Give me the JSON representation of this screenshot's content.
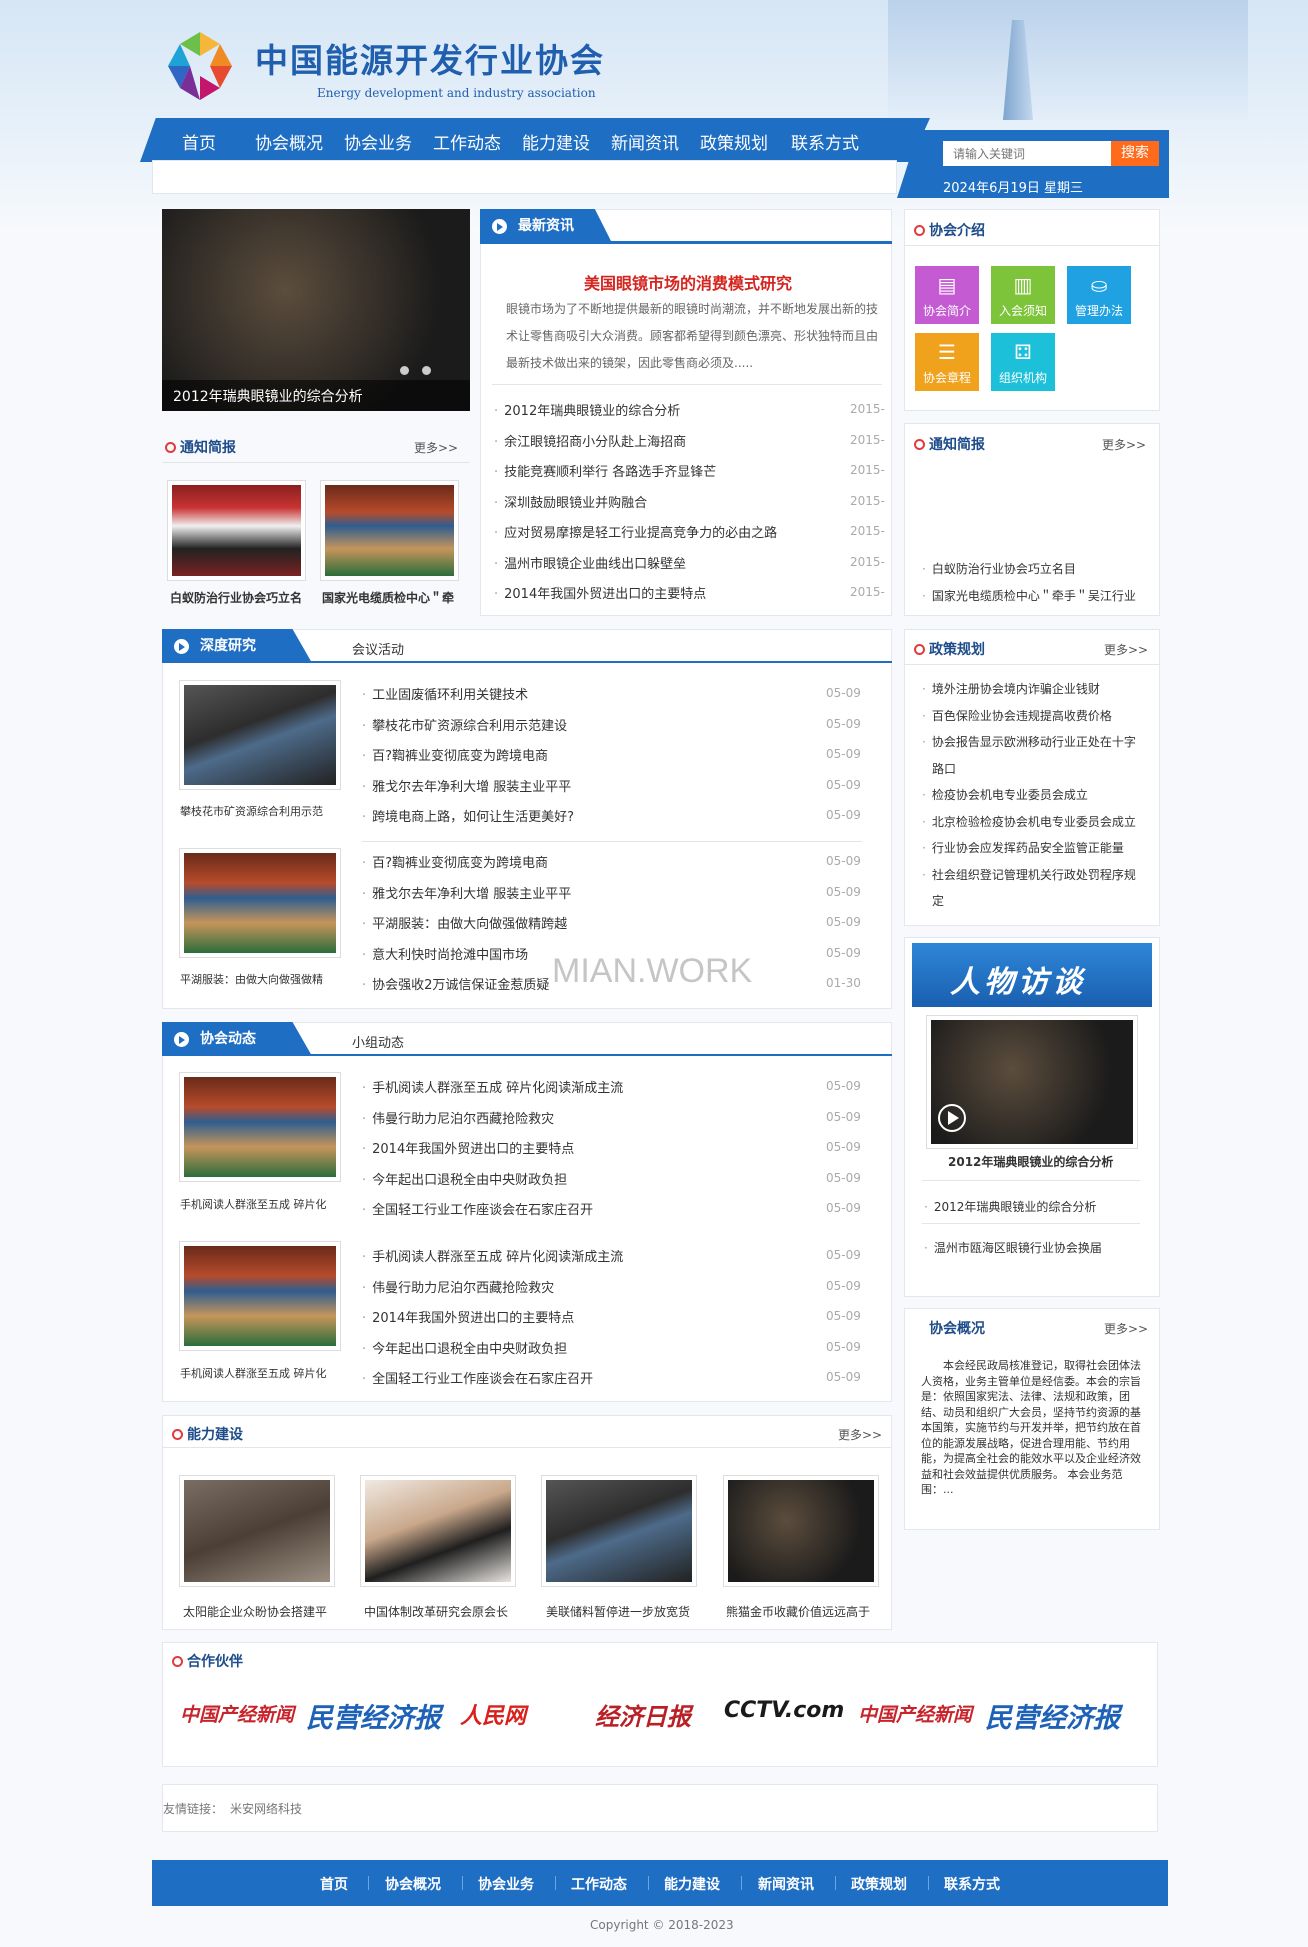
{
  "header": {
    "title": "中国能源开发行业协会",
    "subtitle": "Energy development and industry association"
  },
  "nav": [
    "首页",
    "协会概况",
    "协会业务",
    "工作动态",
    "能力建设",
    "新闻资讯",
    "政策规划",
    "联系方式"
  ],
  "search": {
    "placeholder": "请输入关键词",
    "button": "搜索"
  },
  "date": "2024年6月19日   星期三",
  "slider": {
    "caption": "2012年瑞典眼镜业的综合分析"
  },
  "latest": {
    "tab": "最新资讯",
    "headline": "美国眼镜市场的消费模式研究",
    "summary": "眼镜市场为了不断地提供最新的眼镜时尚潮流，并不断地发展出新的技术让零售商吸引大众消费。顾客都希望得到颜色漂亮、形状独特而且由最新技术做出来的镜架，因此零售商必须及.....",
    "items": [
      {
        "title": "2012年瑞典眼镜业的综合分析",
        "date": "2015-"
      },
      {
        "title": "余江眼镜招商小分队赴上海招商",
        "date": "2015-"
      },
      {
        "title": "技能竞赛顺利举行 各路选手齐显锋芒",
        "date": "2015-"
      },
      {
        "title": "深圳鼓励眼镜业并购融合",
        "date": "2015-"
      },
      {
        "title": "应对贸易摩擦是轻工行业提高竞争力的必由之路",
        "date": "2015-"
      },
      {
        "title": "温州市眼镜企业曲线出口躲壁垒",
        "date": "2015-"
      },
      {
        "title": "2014年我国外贸进出口的主要特点",
        "date": "2015-"
      }
    ]
  },
  "notice_left": {
    "title": "通知简报",
    "more": "更多>>",
    "captions": [
      "白蚁防治行业协会巧立名",
      "国家光电缆质检中心＂牵"
    ]
  },
  "about": {
    "title": "协会介绍",
    "tiles": [
      {
        "label": "协会简介",
        "icon": "▤",
        "color": "#c45bd3"
      },
      {
        "label": "入会须知",
        "icon": "▥",
        "color": "#7dc43a"
      },
      {
        "label": "管理办法",
        "icon": "⛀",
        "color": "#1fa1e2"
      },
      {
        "label": "协会章程",
        "icon": "☰",
        "color": "#f0a21c"
      },
      {
        "label": "组织机构",
        "icon": "⚃",
        "color": "#1cc1d9"
      }
    ]
  },
  "notice_right": {
    "title": "通知简报",
    "more": "更多>>",
    "items": [
      "白蚁防治行业协会巧立名目",
      "国家光电缆质检中心＂牵手＂吴江行业"
    ]
  },
  "research": {
    "tab": "深度研究",
    "tab2": "会议活动",
    "blocks": [
      {
        "caption": "攀枝花市矿资源综合利用示范",
        "items": [
          {
            "title": "工业固废循环利用关键技术",
            "date": "05-09"
          },
          {
            "title": "攀枝花市矿资源综合利用示范建设",
            "date": "05-09"
          },
          {
            "title": "百?鞫裤业变彻底变为跨境电商",
            "date": "05-09"
          },
          {
            "title": "雅戈尔去年净利大增 服装主业平平",
            "date": "05-09"
          },
          {
            "title": "跨境电商上路，如何让生活更美好?",
            "date": "05-09"
          }
        ]
      },
      {
        "caption": "平湖服装：由做大向做强做精",
        "items": [
          {
            "title": "百?鞫裤业变彻底变为跨境电商",
            "date": "05-09"
          },
          {
            "title": "雅戈尔去年净利大增 服装主业平平",
            "date": "05-09"
          },
          {
            "title": "平湖服装：由做大向做强做精跨越",
            "date": "05-09"
          },
          {
            "title": "意大利快时尚抢滩中国市场",
            "date": "05-09"
          },
          {
            "title": "协会强收2万诚信保证金惹质疑",
            "date": "01-30"
          }
        ]
      }
    ]
  },
  "watermark": "MIAN.WORK",
  "policy": {
    "title": "政策规划",
    "more": "更多>>",
    "items": [
      "境外注册协会境内诈骗企业钱财",
      "百色保险业协会违规提高收费价格",
      "协会报告显示欧洲移动行业正处在十字",
      "路口",
      "检疫协会机电专业委员会成立",
      "北京检验检疫协会机电专业委员会成立",
      "行业协会应发挥药品安全监管正能量",
      "社会组织登记管理机关行政处罚程序规",
      "定"
    ]
  },
  "dynamics": {
    "tab": "协会动态",
    "tab2": "小组动态",
    "blocks": [
      {
        "caption": "手机阅读人群涨至五成 碎片化",
        "items": [
          {
            "title": "手机阅读人群涨至五成 碎片化阅读渐成主流",
            "date": "05-09"
          },
          {
            "title": "伟曼行助力尼泊尔西藏抢险救灾",
            "date": "05-09"
          },
          {
            "title": "2014年我国外贸进出口的主要特点",
            "date": "05-09"
          },
          {
            "title": "今年起出口退税全由中央财政负担",
            "date": "05-09"
          },
          {
            "title": "全国轻工行业工作座谈会在石家庄召开",
            "date": "05-09"
          }
        ]
      },
      {
        "caption": "手机阅读人群涨至五成 碎片化",
        "items": [
          {
            "title": "手机阅读人群涨至五成 碎片化阅读渐成主流",
            "date": "05-09"
          },
          {
            "title": "伟曼行助力尼泊尔西藏抢险救灾",
            "date": "05-09"
          },
          {
            "title": "2014年我国外贸进出口的主要特点",
            "date": "05-09"
          },
          {
            "title": "今年起出口退税全由中央财政负担",
            "date": "05-09"
          },
          {
            "title": "全国轻工行业工作座谈会在石家庄召开",
            "date": "05-09"
          }
        ]
      }
    ]
  },
  "interview": {
    "banner": "人物访谈",
    "caption": "2012年瑞典眼镜业的综合分析",
    "items": [
      "2012年瑞典眼镜业的综合分析",
      "温州市瓯海区眼镜行业协会换届"
    ]
  },
  "overview": {
    "title": "协会概况",
    "more": "更多>>",
    "text": "本会经民政局核准登记，取得社会团体法人资格，业务主管单位是经信委。本会的宗旨是：依照国家宪法、法律、法规和政策，团结、动员和组织广大会员，坚持节约资源的基本国策，实施节约与开发并举，把节约放在首位的能源发展战略，促进合理用能、节约用能，为提高全社会的能效水平以及企业经济效益和社会效益提供优质服务。 本会业务范围：..."
  },
  "capability": {
    "title": "能力建设",
    "more": "更多>>",
    "captions": [
      "太阳能企业众盼协会搭建平",
      "中国体制改革研究会原会长",
      "美联储料暂停进一步放宽货",
      "熊猫金币收藏价值远远高于"
    ]
  },
  "partners": {
    "title": "合作伙伴",
    "logos": [
      {
        "text": "中国产经新闻",
        "color": "#c8242c"
      },
      {
        "text": "民营经济报",
        "color": "#1d62b6"
      },
      {
        "text": "人民网",
        "color": "#d8201c"
      },
      {
        "text": "经济日报",
        "color": "#b82025"
      },
      {
        "text": "CCTV.com",
        "color": "#1a1a1a"
      },
      {
        "text": "中国产经新闻",
        "color": "#c8242c"
      },
      {
        "text": "民营经济报",
        "color": "#1d62b6"
      }
    ]
  },
  "links": {
    "label": "友情链接：",
    "items": [
      "米安网络科技"
    ]
  },
  "footer": {
    "nav": [
      "首页",
      "协会概况",
      "协会业务",
      "工作动态",
      "能力建设",
      "新闻资讯",
      "政策规划",
      "联系方式"
    ],
    "copyright": "Copyright © 2018-2023"
  }
}
